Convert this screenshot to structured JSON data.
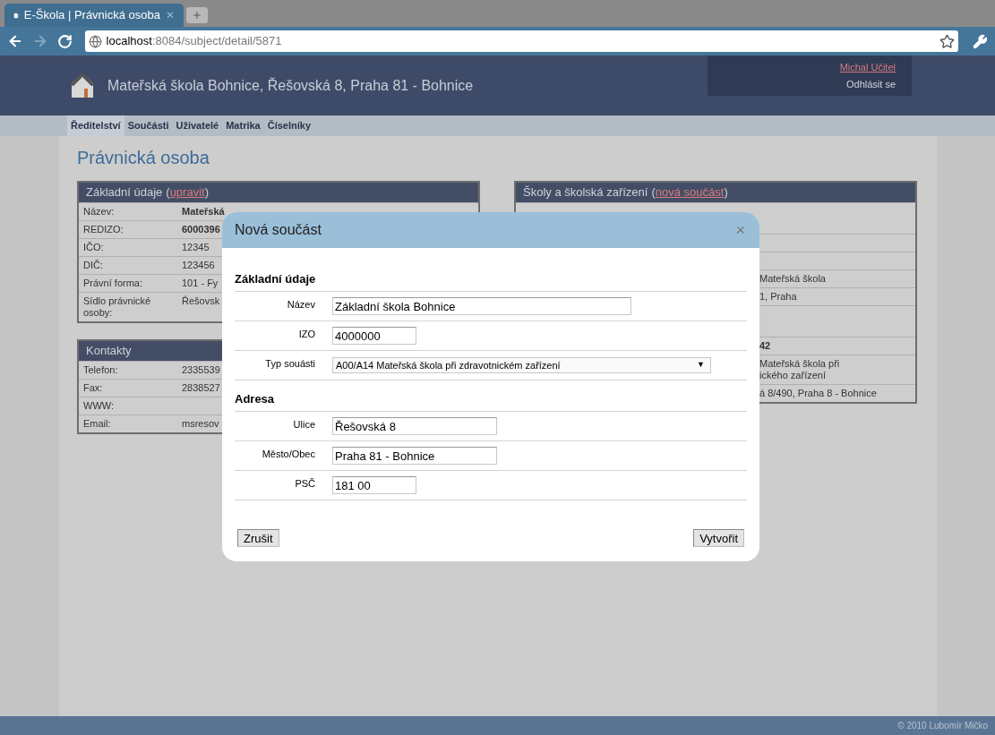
{
  "browser": {
    "tab_title": "E-Škola | Právnická osoba",
    "url_host": "localhost",
    "url_path": ":8084/subject/detail/5871",
    "tab_close": "✕"
  },
  "header": {
    "title": "Mateřská škola Bohnice, Řešovská 8, Praha 81 - Bohnice",
    "user": "Michal Učitel",
    "logout": "Odhlásit se"
  },
  "nav": [
    {
      "label": "Ředitelství",
      "selected": true
    },
    {
      "label": "Součásti",
      "selected": false
    },
    {
      "label": "Uživatelé",
      "selected": false
    },
    {
      "label": "Matrika",
      "selected": false
    },
    {
      "label": "Číselníky",
      "selected": false
    }
  ],
  "page_title": "Právnická osoba",
  "left_panels": [
    {
      "title": "Základní údaje",
      "open": "(",
      "action": "upravit",
      "close": ")",
      "rows": [
        {
          "label": "Název:",
          "value": "Mateřská",
          "bold": true
        },
        {
          "label": "REDIZO:",
          "value": "6000396",
          "bold": true
        },
        {
          "label": "IČO:",
          "value": "12345",
          "bold": false
        },
        {
          "label": "DIČ:",
          "value": "123456",
          "bold": false
        },
        {
          "label": "Právní forma:",
          "value": "101 - Fy",
          "bold": false
        },
        {
          "label": "Sídlo právnické osoby:",
          "value": "Řešovsk",
          "bold": false
        }
      ]
    },
    {
      "title": "Kontakty",
      "rows": [
        {
          "label": "Telefon:",
          "value": "2335539",
          "bold": false
        },
        {
          "label": "Fax:",
          "value": "2838527",
          "bold": false
        },
        {
          "label": "WWW:"
        },
        {
          "label": "Email:",
          "value": "msresov",
          "bold": false
        }
      ]
    }
  ],
  "right_panel": {
    "title": "Školy a školská zařízení",
    "open": "(",
    "action": "nová součást",
    "close": ")",
    "rows": [
      {
        "kind": "tall"
      },
      {
        "kind": "plain"
      },
      {
        "kind": "plain"
      },
      {
        "kind": "plain",
        "lines": [
          "Mateřská škola"
        ]
      },
      {
        "kind": "plain",
        "lines": [
          "1, Praha"
        ]
      },
      {
        "kind": "tall"
      },
      {
        "kind": "plain",
        "lines": [
          "42"
        ],
        "bold": true
      },
      {
        "kind": "plain",
        "lines": [
          "Mateřská škola při",
          "ického zařízení"
        ]
      },
      {
        "kind": "plain",
        "lines": [
          "á 8/490, Praha 8 - Bohnice"
        ]
      }
    ]
  },
  "dialog": {
    "title": "Nová součást",
    "close": "×",
    "sections": [
      {
        "heading": "Základní údaje",
        "fields": [
          {
            "label": "Název",
            "value": "Základní škola Bohnice",
            "kind": "text"
          },
          {
            "label": "IZO",
            "value": "4000000",
            "kind": "text"
          },
          {
            "label": "Typ souásti",
            "value": "A00/A14 Mateřská škola při zdravotnickém zařízení",
            "kind": "select"
          }
        ]
      },
      {
        "heading": "Adresa",
        "fields": [
          {
            "label": "Ulice",
            "value": "Řešovská 8",
            "kind": "text"
          },
          {
            "label": "Město/Obec",
            "value": "Praha 81 - Bohnice",
            "kind": "text"
          },
          {
            "label": "PSČ",
            "value": "181 00",
            "kind": "text"
          }
        ]
      }
    ],
    "cancel": "Zrušit",
    "submit": "Vytvořit",
    "caret": "▼"
  },
  "footer": "© 2010 Lubomír Mičko"
}
